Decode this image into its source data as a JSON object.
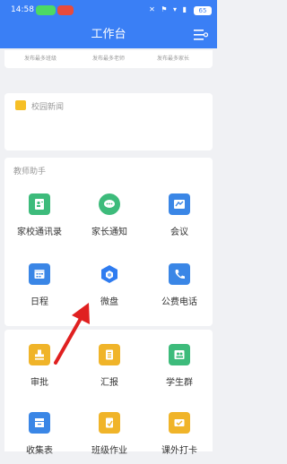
{
  "status_bar": {
    "time": "14:58",
    "battery": "65"
  },
  "header": {
    "title": "工作台"
  },
  "notices": [
    {
      "label": "发布最多班级"
    },
    {
      "label": "发布最多老师"
    },
    {
      "label": "发布最多家长"
    }
  ],
  "news": {
    "label": "校园新闻"
  },
  "assistant": {
    "heading": "教师助手",
    "items": [
      {
        "label": "家校通讯录",
        "icon": "contacts-icon",
        "color": "#3dbb7b"
      },
      {
        "label": "家长通知",
        "icon": "chat-icon",
        "color": "#3dbb7b"
      },
      {
        "label": "会议",
        "icon": "meeting-icon",
        "color": "#3a86e6"
      },
      {
        "label": "日程",
        "icon": "calendar-icon",
        "color": "#3a86e6"
      },
      {
        "label": "微盘",
        "icon": "cloud-drive-icon",
        "color": "#2f7cf0"
      },
      {
        "label": "公费电话",
        "icon": "phone-icon",
        "color": "#3a86e6"
      }
    ]
  },
  "more": {
    "items": [
      {
        "label": "审批",
        "icon": "approval-icon",
        "color": "#f0b429"
      },
      {
        "label": "汇报",
        "icon": "report-icon",
        "color": "#f0b429"
      },
      {
        "label": "学生群",
        "icon": "student-group-icon",
        "color": "#3dbb7b"
      },
      {
        "label": "收集表",
        "icon": "collection-form-icon",
        "color": "#3a86e6"
      },
      {
        "label": "班级作业",
        "icon": "homework-icon",
        "color": "#f0b429"
      },
      {
        "label": "课外打卡",
        "icon": "checkin-icon",
        "color": "#f0b429"
      }
    ]
  },
  "colors": {
    "accent": "#3a7ff5",
    "arrow": "#e02020"
  }
}
